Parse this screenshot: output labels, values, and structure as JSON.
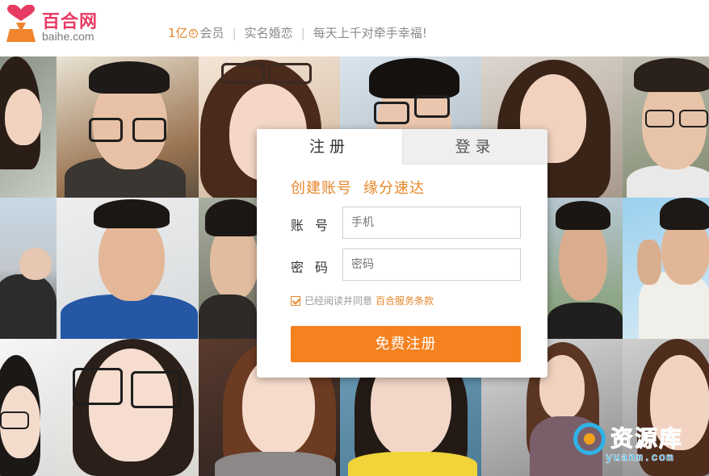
{
  "header": {
    "logo_cn": "百合网",
    "logo_en": "baihe.com",
    "slogan_count": "1亿",
    "slogan_circle": "①",
    "slogan_members": "会员",
    "slogan_realname": "实名婚恋",
    "slogan_daily": "每天上千对牵手幸福!",
    "separator": "|"
  },
  "panel": {
    "tabs": [
      {
        "label": "注册"
      },
      {
        "label": "登录"
      }
    ],
    "headline_1": "创建账号",
    "headline_2": "缘分速达",
    "account_label": "账号",
    "account_placeholder": "手机",
    "password_label": "密码",
    "password_placeholder": "密码",
    "agree_text": "已经阅读并同意",
    "terms_link": "百合服务条款",
    "submit_label": "免费注册"
  },
  "watermark": {
    "title": "资源库",
    "url": "yuanm.com"
  },
  "colors": {
    "brand_pink": "#e83b63",
    "accent_orange": "#e6862a",
    "button_orange": "#f5811f",
    "watermark_blue": "#2b9fd8"
  },
  "icons": {
    "logo": "heart-person-logo-icon",
    "checkbox": "checkmark-icon",
    "watermark": "target-circle-icon"
  }
}
